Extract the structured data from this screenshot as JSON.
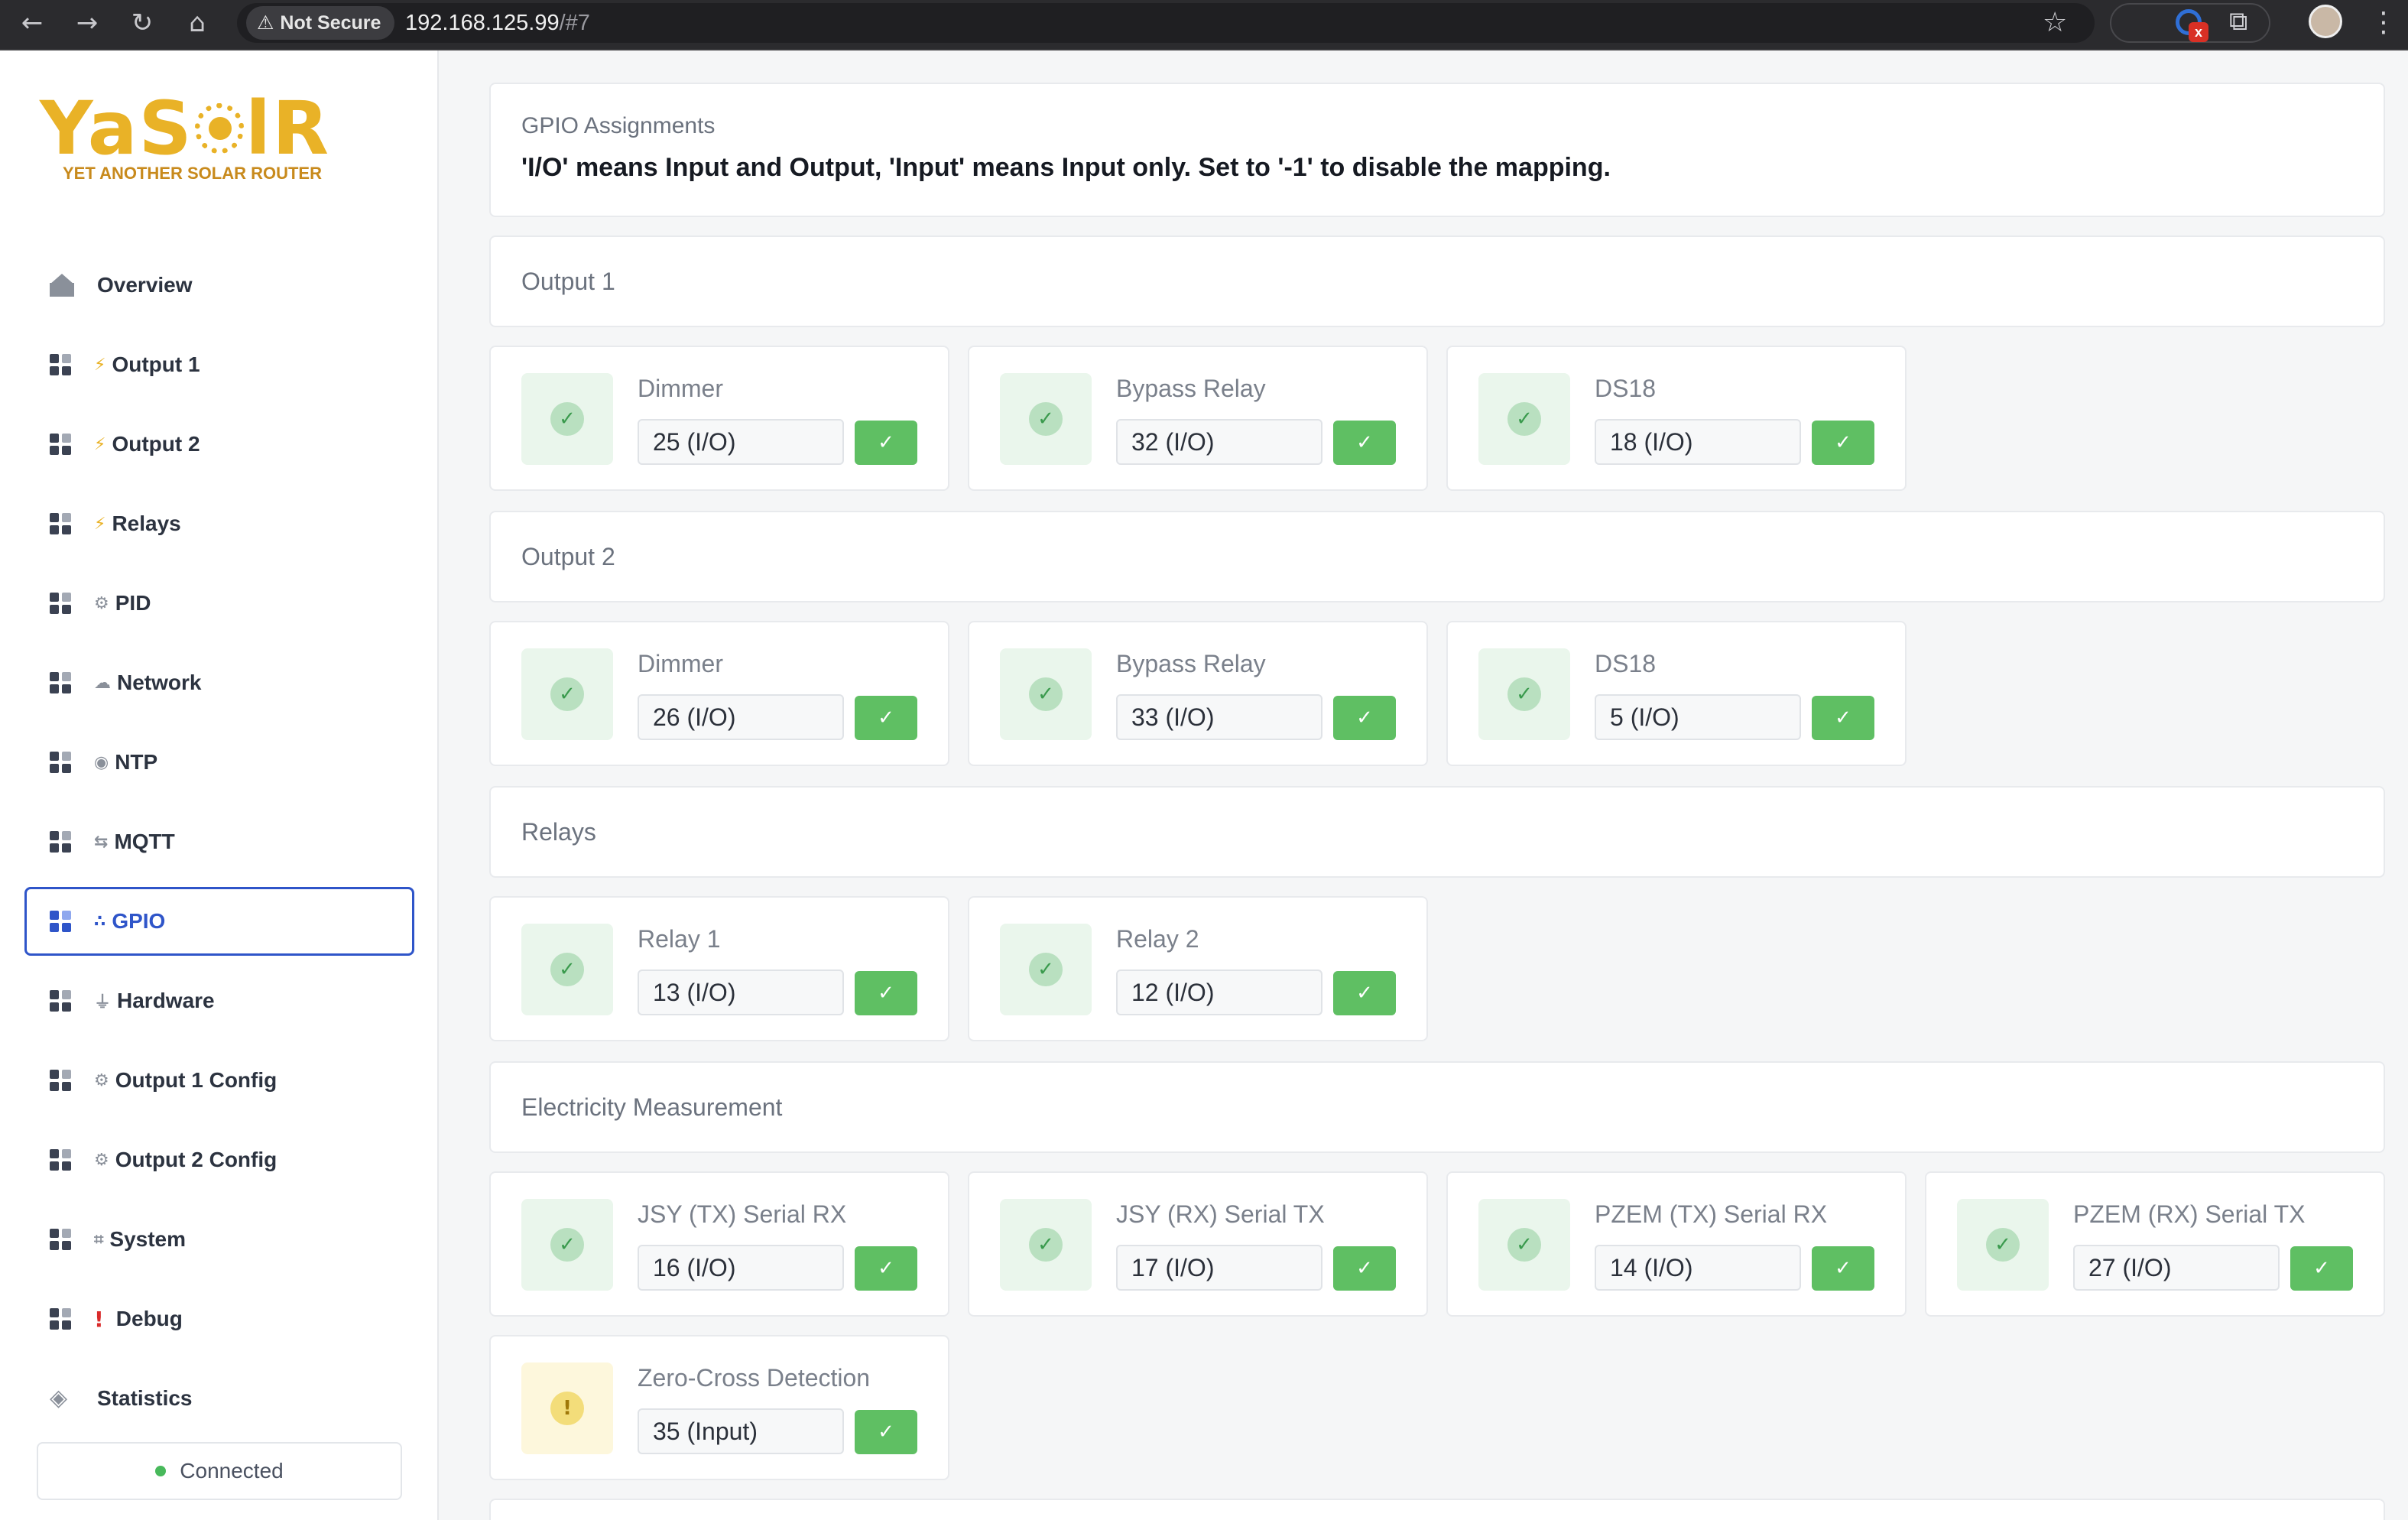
{
  "browser": {
    "security_label": "Not Secure",
    "url_host": "192.168.125.99",
    "url_hash": "/#7"
  },
  "logo": {
    "word_left": "YaS",
    "word_right": "lR",
    "tagline": "YET ANOTHER SOLAR ROUTER"
  },
  "sidebar": {
    "items": [
      {
        "label": "Overview",
        "icon": "home-icon"
      },
      {
        "label": "Output 1",
        "icon": "bolt-icon",
        "glyph": "⚡"
      },
      {
        "label": "Output 2",
        "icon": "bolt-icon",
        "glyph": "⚡"
      },
      {
        "label": "Relays",
        "icon": "bolt-icon",
        "glyph": "⚡"
      },
      {
        "label": "PID",
        "icon": "gear-outline-icon",
        "glyph": "⚙"
      },
      {
        "label": "Network",
        "icon": "cloud-icon",
        "glyph": "☁"
      },
      {
        "label": "NTP",
        "icon": "globe-icon",
        "glyph": "◉"
      },
      {
        "label": "MQTT",
        "icon": "arrows-icon",
        "glyph": "⇆"
      },
      {
        "label": "GPIO",
        "icon": "pins-icon",
        "glyph": "∴",
        "active": true
      },
      {
        "label": "Hardware",
        "icon": "plug-icon",
        "glyph": "⏚"
      },
      {
        "label": "Output 1 Config",
        "icon": "gear-icon",
        "glyph": "⚙"
      },
      {
        "label": "Output 2 Config",
        "icon": "gear-icon",
        "glyph": "⚙"
      },
      {
        "label": "System",
        "icon": "chip-icon",
        "glyph": "⌗"
      },
      {
        "label": "Debug",
        "icon": "exclamation-icon",
        "glyph": "!"
      },
      {
        "label": "Statistics",
        "icon": "layers-icon"
      }
    ],
    "status": "Connected"
  },
  "header": {
    "title": "GPIO Assignments",
    "description": "'I/O' means Input and Output, 'Input' means Input only. Set to '-1' to disable the mapping."
  },
  "sections": {
    "output1": {
      "title": "Output 1",
      "pins": [
        {
          "label": "Dimmer",
          "value": "25 (I/O)",
          "status": "ok"
        },
        {
          "label": "Bypass Relay",
          "value": "32 (I/O)",
          "status": "ok"
        },
        {
          "label": "DS18",
          "value": "18 (I/O)",
          "status": "ok"
        }
      ]
    },
    "output2": {
      "title": "Output 2",
      "pins": [
        {
          "label": "Dimmer",
          "value": "26 (I/O)",
          "status": "ok"
        },
        {
          "label": "Bypass Relay",
          "value": "33 (I/O)",
          "status": "ok"
        },
        {
          "label": "DS18",
          "value": "5 (I/O)",
          "status": "ok"
        }
      ]
    },
    "relays": {
      "title": "Relays",
      "pins": [
        {
          "label": "Relay 1",
          "value": "13 (I/O)",
          "status": "ok"
        },
        {
          "label": "Relay 2",
          "value": "12 (I/O)",
          "status": "ok"
        }
      ]
    },
    "electricity": {
      "title": "Electricity Measurement",
      "pins": [
        {
          "label": "JSY (TX) Serial RX",
          "value": "16 (I/O)",
          "status": "ok"
        },
        {
          "label": "JSY (RX) Serial TX",
          "value": "17 (I/O)",
          "status": "ok"
        },
        {
          "label": "PZEM (TX) Serial RX",
          "value": "14 (I/O)",
          "status": "ok"
        },
        {
          "label": "PZEM (RX) Serial TX",
          "value": "27 (I/O)",
          "status": "ok"
        },
        {
          "label": "Zero-Cross Detection",
          "value": "35 (Input)",
          "status": "warning"
        }
      ]
    }
  },
  "colors": {
    "accent": "#2f55c9",
    "ok": "#5fbf63",
    "logo": "#e9b227",
    "warning": "#f3dd7a"
  }
}
